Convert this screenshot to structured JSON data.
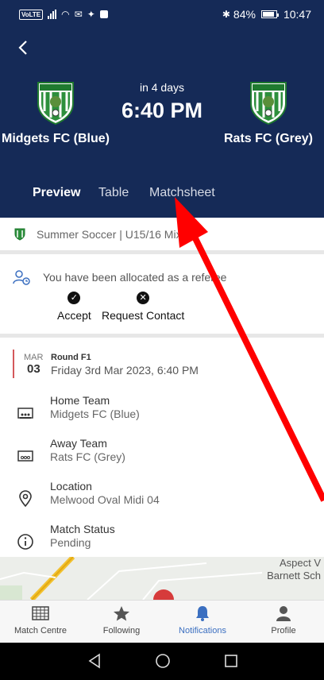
{
  "status_bar": {
    "battery": "84%",
    "time": "10:47",
    "volte": "VoLTE"
  },
  "match": {
    "home_team": "Midgets FC (Blue)",
    "away_team": "Rats FC (Grey)",
    "relative": "in 4 days",
    "time": "6:40 PM",
    "crest_text": "CREST KILLARNEY"
  },
  "tabs": [
    "Preview",
    "Table",
    "Matchsheet"
  ],
  "competition": "Summer Soccer | U15/16 Mixe",
  "referee": {
    "message": "You have been allocated as a referee",
    "accept_label": "Accept",
    "request_label": "Request Contact"
  },
  "round": {
    "month": "MAR",
    "day": "03",
    "name": "Round F1",
    "datetime": "Friday 3rd Mar 2023, 6:40 PM"
  },
  "details": [
    {
      "label": "Home Team",
      "value": "Midgets FC (Blue)",
      "icon": "home-team-icon"
    },
    {
      "label": "Away Team",
      "value": "Rats FC (Grey)",
      "icon": "away-team-icon"
    },
    {
      "label": "Location",
      "value": "Melwood Oval Midi 04",
      "icon": "location-pin-icon"
    },
    {
      "label": "Match Status",
      "value": "Pending",
      "icon": "info-icon"
    }
  ],
  "map": {
    "place_line1": "Aspect V",
    "place_line2": "Barnett Sch"
  },
  "bottom_nav": [
    "Match Centre",
    "Following",
    "Notifications",
    "Profile"
  ],
  "colors": {
    "header": "#152a57",
    "accent": "#3b6fc0",
    "round_bar": "#d4585b",
    "arrow": "#ff0000"
  }
}
